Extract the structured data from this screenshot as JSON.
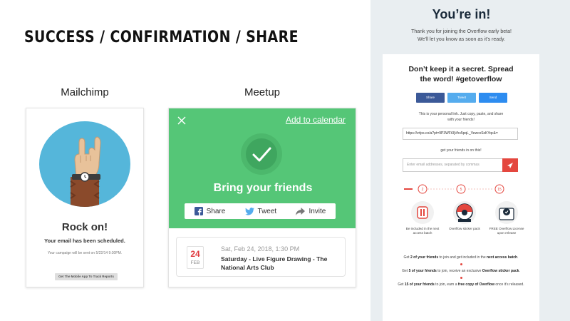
{
  "slide": {
    "title": "SUCCESS / CONFIRMATION / SHARE"
  },
  "mailchimp": {
    "label": "Mailchimp",
    "title": "Rock on!",
    "subtitle": "Your email has been scheduled.",
    "note": "Your campaign will be sent on 5/22/14 9:30PM.",
    "button_label": "Get The Mobile App To Track Reports",
    "icon": "rock-hand-illustration",
    "accent": "#55b6da"
  },
  "meetup": {
    "label": "Meetup",
    "add_to_calendar": "Add to calendar",
    "title": "Bring your friends",
    "accent": "#55c677",
    "share": [
      {
        "label": "Share",
        "icon": "facebook-icon"
      },
      {
        "label": "Tweet",
        "icon": "twitter-icon"
      },
      {
        "label": "Invite",
        "icon": "share-arrow-icon"
      }
    ],
    "event": {
      "day": "24",
      "month": "FEB",
      "when": "Sat, Feb 24, 2018, 1:30 PM",
      "what": "Saturday - Live Figure Drawing - The National Arts Club"
    }
  },
  "overflow": {
    "title": "You’re in!",
    "thanks_line1": "Thank you for joining the Overflow early beta!",
    "thanks_line2": "We’ll let you know as soon as it’s ready.",
    "card_title_line1": "Don’t keep it a secret. Spread",
    "card_title_line2": "the word! #getoverflow",
    "share": [
      {
        "label": "Share",
        "color": "#3b5998"
      },
      {
        "label": "Tweet",
        "color": "#55acee"
      },
      {
        "label": "Send",
        "color": "#2d8cf0"
      }
    ],
    "link_note_line1": "This is your personal link. Just copy, paste, and share",
    "link_note_line2": "with your friends!",
    "url": "https://vrlps.co/a?pt=9P3WFt3jVhs5pqL_VewcxSxKYqc&=",
    "friends_label": "get your friends in on this!",
    "email_placeholder": "Enter email addresses, separated by commas",
    "steps": [
      "2",
      "5",
      "15"
    ],
    "accent": "#e4473f",
    "rewards": [
      {
        "text": "Be included in the next access batch",
        "icon": "overflow-logo-icon"
      },
      {
        "text": "Overflow sticker pack",
        "icon": "sticker-pack-icon"
      },
      {
        "text": "FREE Overflow License upon release",
        "icon": "license-badge-icon"
      }
    ],
    "goals": [
      {
        "pre": "Get ",
        "bold1": "2 of your friends",
        "mid": " to join and get included in the ",
        "bold2": "next access batch",
        "post": "."
      },
      {
        "pre": "Get ",
        "bold1": "5 of your friends",
        "mid": " to join, receive an exclusive ",
        "bold2": "Overflow sticker pack",
        "post": "."
      },
      {
        "pre": "Get ",
        "bold1": "15 of your friends",
        "mid": " to join, earn a ",
        "bold2": "free copy of Overflow",
        "post": " once it’s released."
      }
    ]
  }
}
